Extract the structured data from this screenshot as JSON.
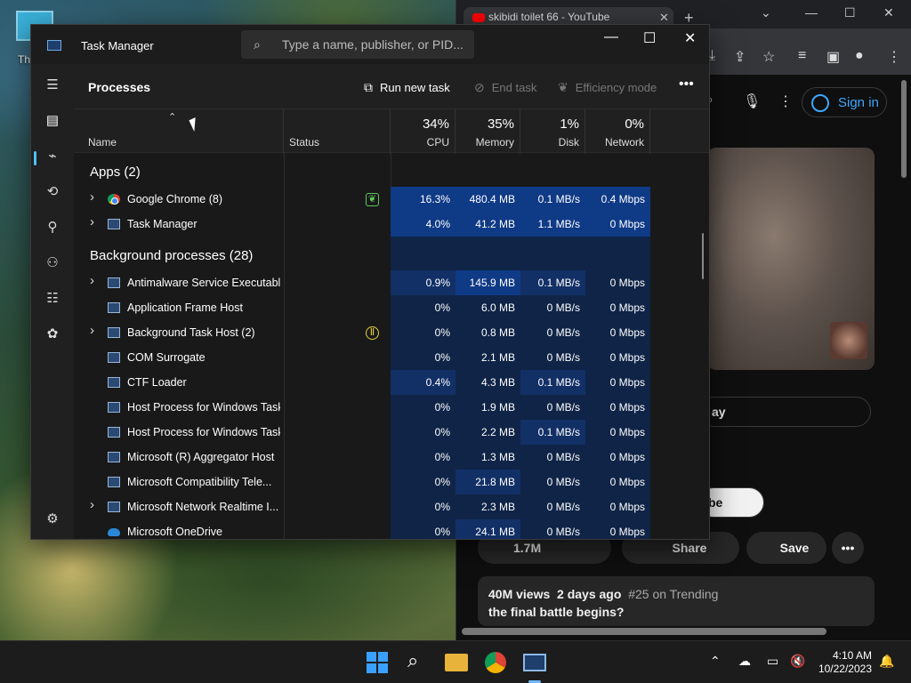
{
  "desktop": {
    "icon_label": "Th"
  },
  "browser": {
    "tab_title": "skibidi toilet 66 - YouTube",
    "sign_in": "Sign in",
    "partial_pill_1": "ay",
    "partial_pill_2": "be",
    "likes": "1.7M",
    "share": "Share",
    "save": "Save",
    "views": "40M views",
    "age": "2 days ago",
    "trending": "#25 on Trending",
    "description_line": "the final battle begins?"
  },
  "task_manager": {
    "title": "Task Manager",
    "search_placeholder": "Type a name, publisher, or PID...",
    "page_title": "Processes",
    "run_new_task": "Run new task",
    "end_task": "End task",
    "efficiency_mode": "Efficiency mode",
    "columns": {
      "name": "Name",
      "status": "Status",
      "cpu": {
        "pct": "34%",
        "label": "CPU"
      },
      "memory": {
        "pct": "35%",
        "label": "Memory"
      },
      "disk": {
        "pct": "1%",
        "label": "Disk"
      },
      "network": {
        "pct": "0%",
        "label": "Network"
      }
    },
    "apps_group": "Apps (2)",
    "bg_group": "Background processes (28)",
    "apps": [
      {
        "name": "Google Chrome (8)",
        "cpu": "16.3%",
        "memory": "480.4 MB",
        "disk": "0.1 MB/s",
        "network": "0.4 Mbps"
      },
      {
        "name": "Task Manager",
        "cpu": "4.0%",
        "memory": "41.2 MB",
        "disk": "1.1 MB/s",
        "network": "0 Mbps"
      }
    ],
    "background": [
      {
        "name": "Antimalware Service Executable",
        "cpu": "0.9%",
        "memory": "145.9 MB",
        "disk": "0.1 MB/s",
        "network": "0 Mbps"
      },
      {
        "name": "Application Frame Host",
        "cpu": "0%",
        "memory": "6.0 MB",
        "disk": "0 MB/s",
        "network": "0 Mbps"
      },
      {
        "name": "Background Task Host (2)",
        "cpu": "0%",
        "memory": "0.8 MB",
        "disk": "0 MB/s",
        "network": "0 Mbps"
      },
      {
        "name": "COM Surrogate",
        "cpu": "0%",
        "memory": "2.1 MB",
        "disk": "0 MB/s",
        "network": "0 Mbps"
      },
      {
        "name": "CTF Loader",
        "cpu": "0.4%",
        "memory": "4.3 MB",
        "disk": "0.1 MB/s",
        "network": "0 Mbps"
      },
      {
        "name": "Host Process for Windows Tasks",
        "cpu": "0%",
        "memory": "1.9 MB",
        "disk": "0 MB/s",
        "network": "0 Mbps"
      },
      {
        "name": "Host Process for Windows Tasks",
        "cpu": "0%",
        "memory": "2.2 MB",
        "disk": "0.1 MB/s",
        "network": "0 Mbps"
      },
      {
        "name": "Microsoft (R) Aggregator Host",
        "cpu": "0%",
        "memory": "1.3 MB",
        "disk": "0 MB/s",
        "network": "0 Mbps"
      },
      {
        "name": "Microsoft Compatibility Tele...",
        "cpu": "0%",
        "memory": "21.8 MB",
        "disk": "0 MB/s",
        "network": "0 Mbps"
      },
      {
        "name": "Microsoft Network Realtime I...",
        "cpu": "0%",
        "memory": "2.3 MB",
        "disk": "0 MB/s",
        "network": "0 Mbps"
      },
      {
        "name": "Microsoft OneDrive",
        "cpu": "0%",
        "memory": "24.1 MB",
        "disk": "0 MB/s",
        "network": "0 Mbps"
      }
    ]
  },
  "taskbar": {
    "time": "4:10 AM",
    "date": "10/22/2023"
  },
  "colors": {
    "cell_high": "#0f3a86",
    "cell_mid": "#123066",
    "cell_low": "#0f2447",
    "accent": "#4cc2ff"
  }
}
